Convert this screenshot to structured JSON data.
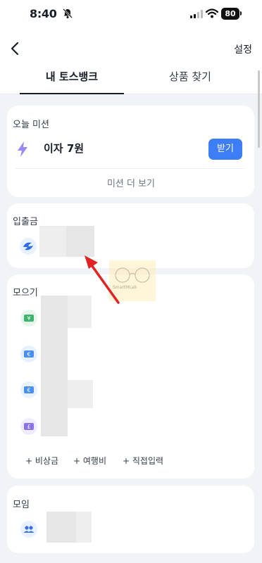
{
  "status_bar": {
    "time": "8:40",
    "battery": "80"
  },
  "navbar": {
    "settings_label": "설정"
  },
  "tabs": [
    {
      "label": "내 토스뱅크",
      "active": true
    },
    {
      "label": "상품 찾기",
      "active": false
    }
  ],
  "mission_card": {
    "title": "오늘 미션",
    "reward": "이자 7원",
    "receive_button": "받기",
    "more_link": "미션 더 보기"
  },
  "deposit_card": {
    "title": "입출금"
  },
  "savings_card": {
    "title": "모으기",
    "currency_icons": [
      {
        "symbol": "¥",
        "color": "#3cb469"
      },
      {
        "symbol": "€",
        "color": "#4a8ef0"
      },
      {
        "symbol": "€",
        "color": "#4a8ef0"
      },
      {
        "symbol": "£",
        "color": "#8a74e8"
      }
    ],
    "chips": [
      "+ 비상금",
      "+ 여행비",
      "+ 직접입력"
    ]
  },
  "group_card": {
    "title": "모임"
  },
  "watermark": "SmartMLab",
  "colors": {
    "accent": "#3d7ef6",
    "text": "#191f28",
    "background": "#f2f3f6"
  }
}
